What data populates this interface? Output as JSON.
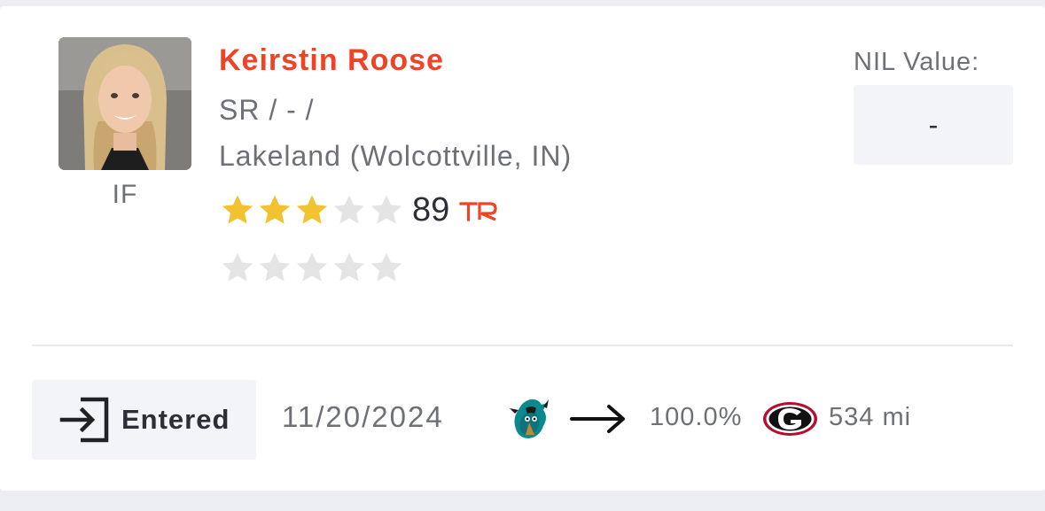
{
  "player": {
    "name": "Keirstin Roose",
    "position": "IF",
    "class_line": "SR / - /",
    "school": "Lakeland (Wolcottville, IN)",
    "rating": "89",
    "rating_source_icon": "tr-logo-icon",
    "stars_filled": 3,
    "stars_total": 5,
    "secondary_stars_filled": 0,
    "secondary_stars_total": 5
  },
  "nil": {
    "label": "NIL Value:",
    "value": "-"
  },
  "transfer": {
    "status_icon": "enter-icon",
    "status_label": "Entered",
    "date": "11/20/2024",
    "from_logo": "coastal-carolina-logo-icon",
    "arrow_icon": "arrow-right-icon",
    "percent": "100.0%",
    "to_logo": "georgia-logo-icon",
    "distance": "534 mi"
  },
  "colors": {
    "accent": "#ee4325",
    "star_filled": "#f2c230",
    "star_empty": "#e4e4e4",
    "text_muted": "#6e7077",
    "text_dark": "#2c2f36"
  }
}
